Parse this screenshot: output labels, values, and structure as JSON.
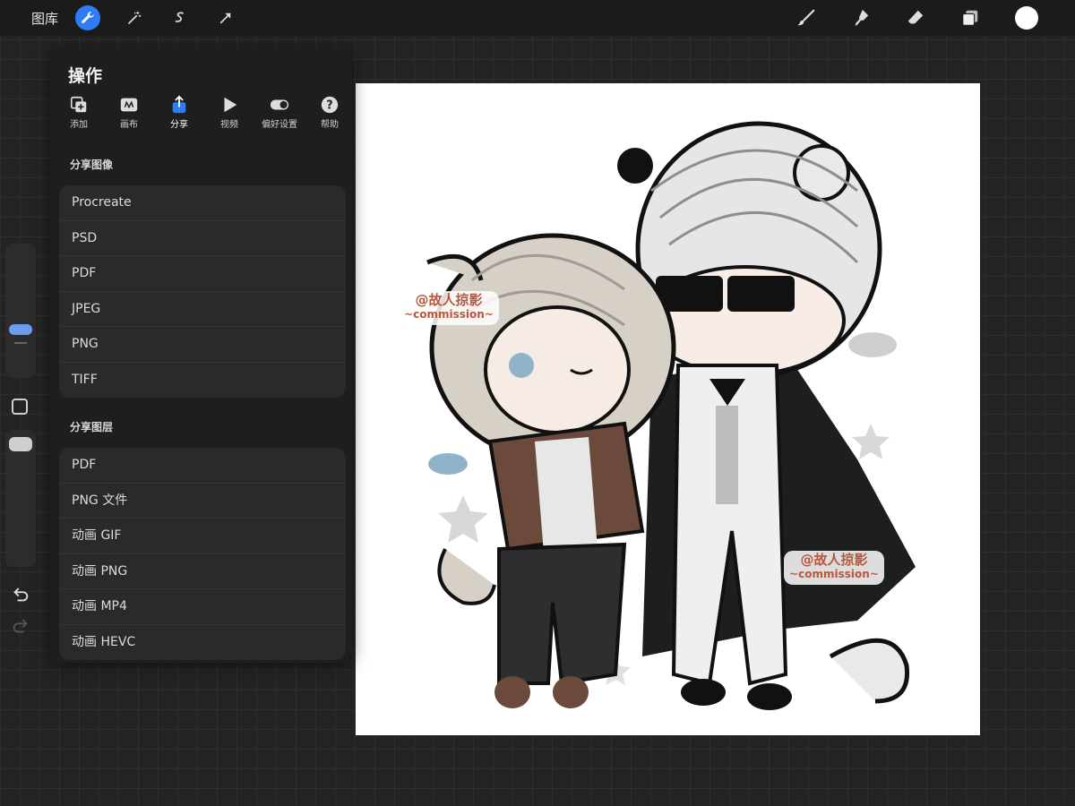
{
  "topbar": {
    "gallery_label": "图库",
    "tools_left": [
      "wrench-icon",
      "magic-wand-icon",
      "selection-icon",
      "transform-arrow-icon"
    ],
    "tools_right": [
      "brush-icon",
      "smudge-icon",
      "eraser-icon",
      "layers-icon"
    ],
    "color": "#ffffff",
    "accent": "#2f7df6"
  },
  "panel": {
    "title": "操作",
    "tabs": [
      {
        "label": "添加",
        "icon": "add-icon"
      },
      {
        "label": "画布",
        "icon": "canvas-icon"
      },
      {
        "label": "分享",
        "icon": "share-icon"
      },
      {
        "label": "视频",
        "icon": "play-icon"
      },
      {
        "label": "偏好设置",
        "icon": "toggle-icon"
      },
      {
        "label": "帮助",
        "icon": "help-icon"
      }
    ],
    "active_tab": "分享",
    "share_image": {
      "title": "分享图像",
      "items": [
        "Procreate",
        "PSD",
        "PDF",
        "JPEG",
        "PNG",
        "TIFF"
      ]
    },
    "share_layers": {
      "title": "分享图层",
      "items": [
        "PDF",
        "PNG 文件",
        "动画 GIF",
        "动画 PNG",
        "动画 MP4",
        "动画 HEVC"
      ]
    }
  },
  "canvas": {
    "watermark_top": "@故人掠影",
    "watermark_sub": "~commission~"
  }
}
